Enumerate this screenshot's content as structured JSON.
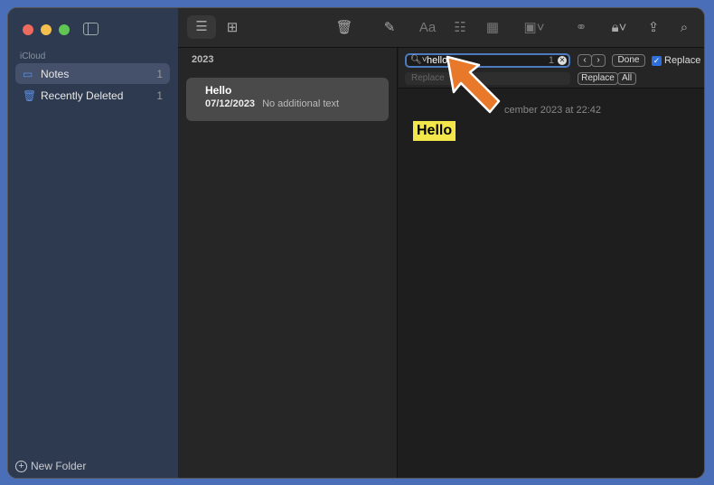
{
  "sidebar": {
    "section": "iCloud",
    "items": [
      {
        "label": "Notes",
        "count": "1",
        "icon": "folder-icon"
      },
      {
        "label": "Recently Deleted",
        "count": "1",
        "icon": "trash-icon"
      }
    ],
    "new_folder": "New Folder"
  },
  "list": {
    "year": "2023",
    "notes": [
      {
        "title": "Hello",
        "date": "07/12/2023",
        "preview": "No additional text"
      }
    ]
  },
  "find": {
    "query": "hello",
    "match_count": "1",
    "replace_placeholder": "Replace",
    "done": "Done",
    "replace_checkbox": "Replace",
    "replace_checked": true,
    "replace_btn": "Replace",
    "all_btn": "All"
  },
  "editor": {
    "date": "cember 2023 at 22:42",
    "body": "Hello"
  },
  "toolbar": {
    "format_label": "Aa"
  },
  "colors": {
    "accent": "#2f6fdc",
    "highlight": "#f3e64a",
    "arrow": "#e8782a"
  }
}
